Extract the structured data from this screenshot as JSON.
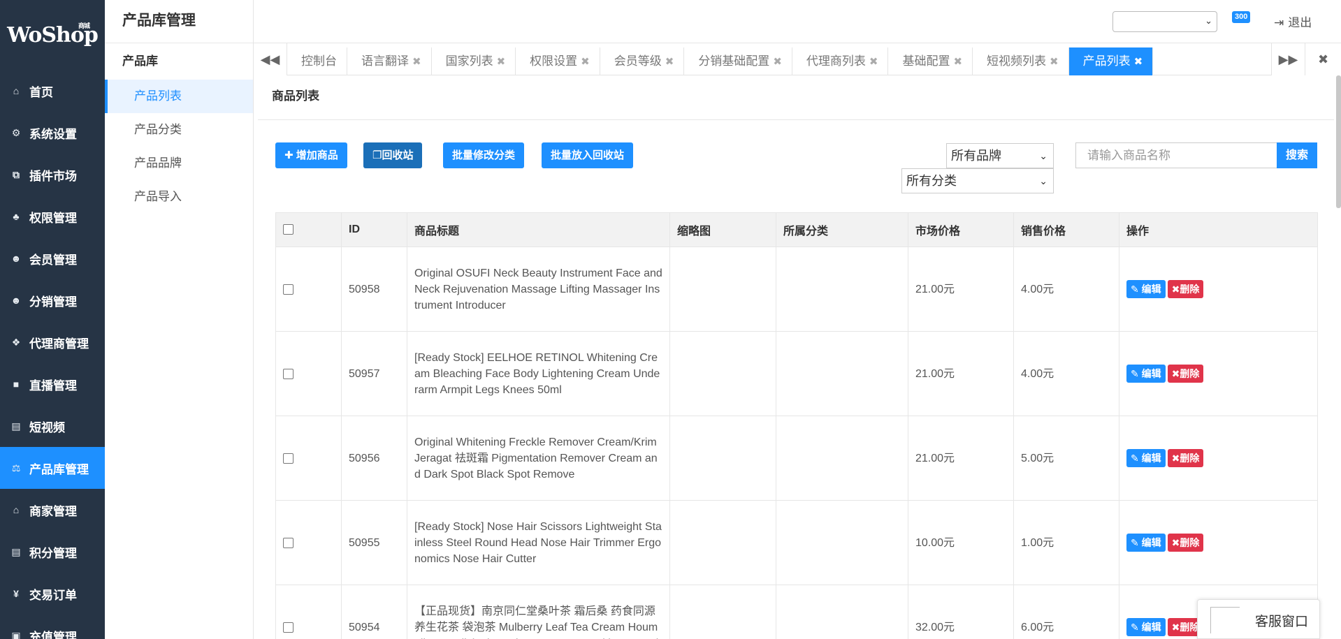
{
  "logo": {
    "text": "WoShop",
    "sup": "商城"
  },
  "nav": [
    {
      "label": "首页",
      "icon": "home-icon",
      "glyph": "⌂"
    },
    {
      "label": "系统设置",
      "icon": "gear-icon",
      "glyph": "⚙"
    },
    {
      "label": "插件市场",
      "icon": "puzzle-icon",
      "glyph": "⧉"
    },
    {
      "label": "权限管理",
      "icon": "sitemap-icon",
      "glyph": "♣"
    },
    {
      "label": "会员管理",
      "icon": "users-icon",
      "glyph": "☻"
    },
    {
      "label": "分销管理",
      "icon": "users-icon",
      "glyph": "☻"
    },
    {
      "label": "代理商管理",
      "icon": "cubes-icon",
      "glyph": "❖"
    },
    {
      "label": "直播管理",
      "icon": "video-camera-icon",
      "glyph": "■"
    },
    {
      "label": "短视频",
      "icon": "file-icon",
      "glyph": "▤"
    },
    {
      "label": "产品库管理",
      "icon": "balance-scale-icon",
      "glyph": "⚖"
    },
    {
      "label": "商家管理",
      "icon": "bank-icon",
      "glyph": "⌂"
    },
    {
      "label": "积分管理",
      "icon": "file-points-icon",
      "glyph": "▤"
    },
    {
      "label": "交易订单",
      "icon": "yen-icon",
      "glyph": "¥"
    },
    {
      "label": "充值管理",
      "icon": "recharge-icon",
      "glyph": "▣"
    }
  ],
  "subside": {
    "title": "产品库管理",
    "group": "产品库",
    "items": [
      "产品列表",
      "产品分类",
      "产品品牌",
      "产品导入"
    ]
  },
  "header": {
    "badge": "300",
    "logout": "退出"
  },
  "tabs": [
    "控制台",
    "语言翻译",
    "国家列表",
    "权限设置",
    "会员等级",
    "分销基础配置",
    "代理商列表",
    "基础配置",
    "短视频列表",
    "产品列表"
  ],
  "panel": {
    "title": "商品列表",
    "add_btn": "增加商品",
    "recycle_btn": "回收站",
    "batch_category_btn": "批量修改分类",
    "batch_recycle_btn": "批量放入回收站",
    "brand_select": "所有品牌",
    "category_select": "所有分类",
    "search_placeholder": "请输入商品名称",
    "search_btn": "搜索"
  },
  "table": {
    "headers": [
      "ID",
      "商品标题",
      "缩略图",
      "所属分类",
      "市场价格",
      "销售价格",
      "操作"
    ],
    "edit_label": "编辑",
    "delete_label": "删除",
    "rows": [
      {
        "id": "50958",
        "title": "Original OSUFI Neck Beauty Instrument Face and Neck Rejuvenation Massage Lifting Massager Instrument Introducer",
        "market": "21.00元",
        "sale": "4.00元"
      },
      {
        "id": "50957",
        "title": "[Ready Stock] EELHOE RETINOL Whitening Cream Bleaching Face Body Lightening Cream Underarm Armpit Legs Knees 50ml",
        "market": "21.00元",
        "sale": "4.00元"
      },
      {
        "id": "50956",
        "title": "Original Whitening Freckle Remover Cream/Krim Jeragat 祛斑霜 Pigmentation Remover Cream and Dark Spot Black Spot Remove",
        "market": "21.00元",
        "sale": "5.00元"
      },
      {
        "id": "50955",
        "title": "[Ready Stock] Nose Hair Scissors Lightweight Stainless Steel Round Head Nose Hair Trimmer Ergonomics Nose Hair Cutter",
        "market": "10.00元",
        "sale": "1.00元"
      },
      {
        "id": "50954",
        "title": "【正品现货】南京同仁堂桑叶茶 霜后桑 药食同源 养生花茶 袋泡茶 Mulberry Leaf Tea Cream Houmulber Medicinal Food Same Yuan Health Scented",
        "market": "32.00元",
        "sale": "6.00元"
      }
    ]
  },
  "service": {
    "label": "客服窗口"
  },
  "colors": {
    "sidebar": "#263445",
    "accent": "#1e90ff",
    "danger": "#e0344a"
  }
}
